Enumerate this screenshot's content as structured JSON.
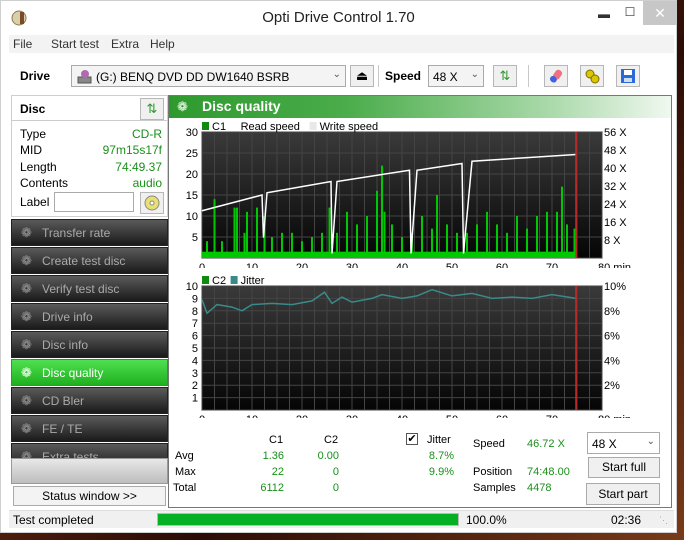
{
  "window": {
    "title": "Opti Drive Control 1.70",
    "minimize": "▬",
    "maximize": "☐",
    "close": "✕"
  },
  "menu": [
    "File",
    "Start test",
    "Extra",
    "Help"
  ],
  "toolbar": {
    "drive_label": "Drive",
    "drive_value": "(G:)  BENQ DVD DD DW1640 BSRB",
    "speed_label": "Speed",
    "speed_value": "48 X",
    "icons": [
      "eject-icon",
      "refresh-icon",
      "erase-icon",
      "settings-icon",
      "save-icon"
    ]
  },
  "disc": {
    "heading": "Disc",
    "rows": [
      {
        "key": "Type",
        "value": "CD-R"
      },
      {
        "key": "MID",
        "value": "97m15s17f"
      },
      {
        "key": "Length",
        "value": "74:49.37"
      },
      {
        "key": "Contents",
        "value": "audio"
      }
    ],
    "label_key": "Label",
    "label_value": ""
  },
  "nav": [
    {
      "label": "Transfer rate",
      "active": false
    },
    {
      "label": "Create test disc",
      "active": false
    },
    {
      "label": "Verify test disc",
      "active": false
    },
    {
      "label": "Drive info",
      "active": false
    },
    {
      "label": "Disc info",
      "active": false
    },
    {
      "label": "Disc quality",
      "active": true
    },
    {
      "label": "CD Bler",
      "active": false
    },
    {
      "label": "FE / TE",
      "active": false
    },
    {
      "label": "Extra tests",
      "active": false
    }
  ],
  "status_window_label": "Status window >>",
  "main": {
    "title": "Disc quality"
  },
  "stats": {
    "col_c1": "C1",
    "col_c2": "C2",
    "jitter_label": "Jitter",
    "jitter_checked": true,
    "rows": [
      {
        "label": "Avg",
        "c1": "1.36",
        "c2": "0.00",
        "jitter": "8.7%"
      },
      {
        "label": "Max",
        "c1": "22",
        "c2": "0",
        "jitter": "9.9%"
      },
      {
        "label": "Total",
        "c1": "6112",
        "c2": "0",
        "jitter": ""
      }
    ],
    "speed_label": "Speed",
    "speed_value": "46.72 X",
    "position_label": "Position",
    "position_value": "74:48.00",
    "samples_label": "Samples",
    "samples_value": "4478",
    "speed_select": "48 X",
    "start_full": "Start full",
    "start_part": "Start part"
  },
  "statusbar": {
    "text": "Test completed",
    "progress": 100.0,
    "progress_text": "100.0%",
    "time": "02:36"
  },
  "colors": {
    "accent": "#2e9a2e",
    "c1": "#00c800",
    "read_speed": "#ffffff",
    "jitter": "#3a8a8a",
    "end_marker": "#e02020"
  },
  "chart_data": [
    {
      "type": "bar",
      "title": "C1 / Read speed",
      "legend": [
        "C1",
        "Read speed",
        "Write speed"
      ],
      "xlabel": "min",
      "x_ticks": [
        "0",
        "10",
        "20",
        "30",
        "40",
        "50",
        "60",
        "70",
        "80 min"
      ],
      "xlim": [
        0,
        80
      ],
      "ylim": [
        0,
        30
      ],
      "y_ticks": [
        "5",
        "10",
        "15",
        "20",
        "25",
        "30"
      ],
      "y2_ticks": [
        "8 X",
        "16 X",
        "24 X",
        "32 X",
        "40 X",
        "48 X",
        "56 X"
      ],
      "y2lim": [
        0,
        56
      ],
      "end_marker_min": 74.8,
      "c1_peaks": [
        {
          "x": 1,
          "y": 4
        },
        {
          "x": 2.5,
          "y": 14
        },
        {
          "x": 4,
          "y": 4
        },
        {
          "x": 6.5,
          "y": 12
        },
        {
          "x": 7,
          "y": 12
        },
        {
          "x": 8.5,
          "y": 6
        },
        {
          "x": 9,
          "y": 11
        },
        {
          "x": 11,
          "y": 12
        },
        {
          "x": 12.5,
          "y": 10
        },
        {
          "x": 14,
          "y": 5
        },
        {
          "x": 16,
          "y": 6
        },
        {
          "x": 18,
          "y": 6
        },
        {
          "x": 20,
          "y": 4
        },
        {
          "x": 22,
          "y": 5
        },
        {
          "x": 24,
          "y": 6
        },
        {
          "x": 25.5,
          "y": 12
        },
        {
          "x": 27,
          "y": 6
        },
        {
          "x": 29,
          "y": 11
        },
        {
          "x": 31,
          "y": 8
        },
        {
          "x": 33,
          "y": 10
        },
        {
          "x": 35,
          "y": 16
        },
        {
          "x": 36,
          "y": 22
        },
        {
          "x": 36.5,
          "y": 11
        },
        {
          "x": 38,
          "y": 8
        },
        {
          "x": 40,
          "y": 5
        },
        {
          "x": 42,
          "y": 6
        },
        {
          "x": 44,
          "y": 10
        },
        {
          "x": 46,
          "y": 7
        },
        {
          "x": 47,
          "y": 15
        },
        {
          "x": 49,
          "y": 8
        },
        {
          "x": 51,
          "y": 6
        },
        {
          "x": 53,
          "y": 6
        },
        {
          "x": 55,
          "y": 8
        },
        {
          "x": 57,
          "y": 11
        },
        {
          "x": 59,
          "y": 8
        },
        {
          "x": 61,
          "y": 6
        },
        {
          "x": 63,
          "y": 10
        },
        {
          "x": 65,
          "y": 7
        },
        {
          "x": 67,
          "y": 10
        },
        {
          "x": 69,
          "y": 11
        },
        {
          "x": 71,
          "y": 11
        },
        {
          "x": 72,
          "y": 17
        },
        {
          "x": 73,
          "y": 8
        },
        {
          "x": 74.5,
          "y": 7
        }
      ],
      "read_speed_x": [
        {
          "x": 0,
          "y": 21
        },
        {
          "x": 12,
          "y": 28
        },
        {
          "x": 12.3,
          "y": 9
        },
        {
          "x": 13,
          "y": 29
        },
        {
          "x": 25.8,
          "y": 34
        },
        {
          "x": 26,
          "y": 2
        },
        {
          "x": 27,
          "y": 34
        },
        {
          "x": 41.5,
          "y": 39
        },
        {
          "x": 41.8,
          "y": 2
        },
        {
          "x": 43,
          "y": 39
        },
        {
          "x": 52,
          "y": 42
        },
        {
          "x": 52.3,
          "y": 2
        },
        {
          "x": 54,
          "y": 43
        },
        {
          "x": 74.8,
          "y": 46
        }
      ]
    },
    {
      "type": "line",
      "title": "C2 / Jitter",
      "legend": [
        "C2",
        "Jitter"
      ],
      "xlabel": "min",
      "x_ticks": [
        "0",
        "10",
        "20",
        "30",
        "40",
        "50",
        "60",
        "70",
        "80 min"
      ],
      "xlim": [
        0,
        80
      ],
      "ylim": [
        0,
        10
      ],
      "y_ticks": [
        "1",
        "2",
        "3",
        "4",
        "5",
        "6",
        "7",
        "8",
        "9",
        "10"
      ],
      "y2_ticks": [
        "2%",
        "4%",
        "6%",
        "8%",
        "10%"
      ],
      "y2lim": [
        0,
        10
      ],
      "end_marker_min": 74.8,
      "c2_values": [],
      "jitter_percent": [
        {
          "x": 0,
          "y": 8.9
        },
        {
          "x": 1,
          "y": 7.8
        },
        {
          "x": 3,
          "y": 8.5
        },
        {
          "x": 6,
          "y": 8.3
        },
        {
          "x": 8,
          "y": 8.0
        },
        {
          "x": 10,
          "y": 8.5
        },
        {
          "x": 14,
          "y": 8.6
        },
        {
          "x": 18,
          "y": 8.5
        },
        {
          "x": 22,
          "y": 8.8
        },
        {
          "x": 24.5,
          "y": 9.5
        },
        {
          "x": 26,
          "y": 8.6
        },
        {
          "x": 28,
          "y": 9.1
        },
        {
          "x": 30,
          "y": 8.7
        },
        {
          "x": 34,
          "y": 9.0
        },
        {
          "x": 36,
          "y": 9.3
        },
        {
          "x": 40,
          "y": 9.0
        },
        {
          "x": 43,
          "y": 9.2
        },
        {
          "x": 46,
          "y": 9.7
        },
        {
          "x": 50,
          "y": 9.2
        },
        {
          "x": 54,
          "y": 9.4
        },
        {
          "x": 58,
          "y": 9.0
        },
        {
          "x": 62,
          "y": 9.1
        },
        {
          "x": 66,
          "y": 9.0
        },
        {
          "x": 70,
          "y": 9.3
        },
        {
          "x": 74.8,
          "y": 9.0
        }
      ]
    }
  ]
}
